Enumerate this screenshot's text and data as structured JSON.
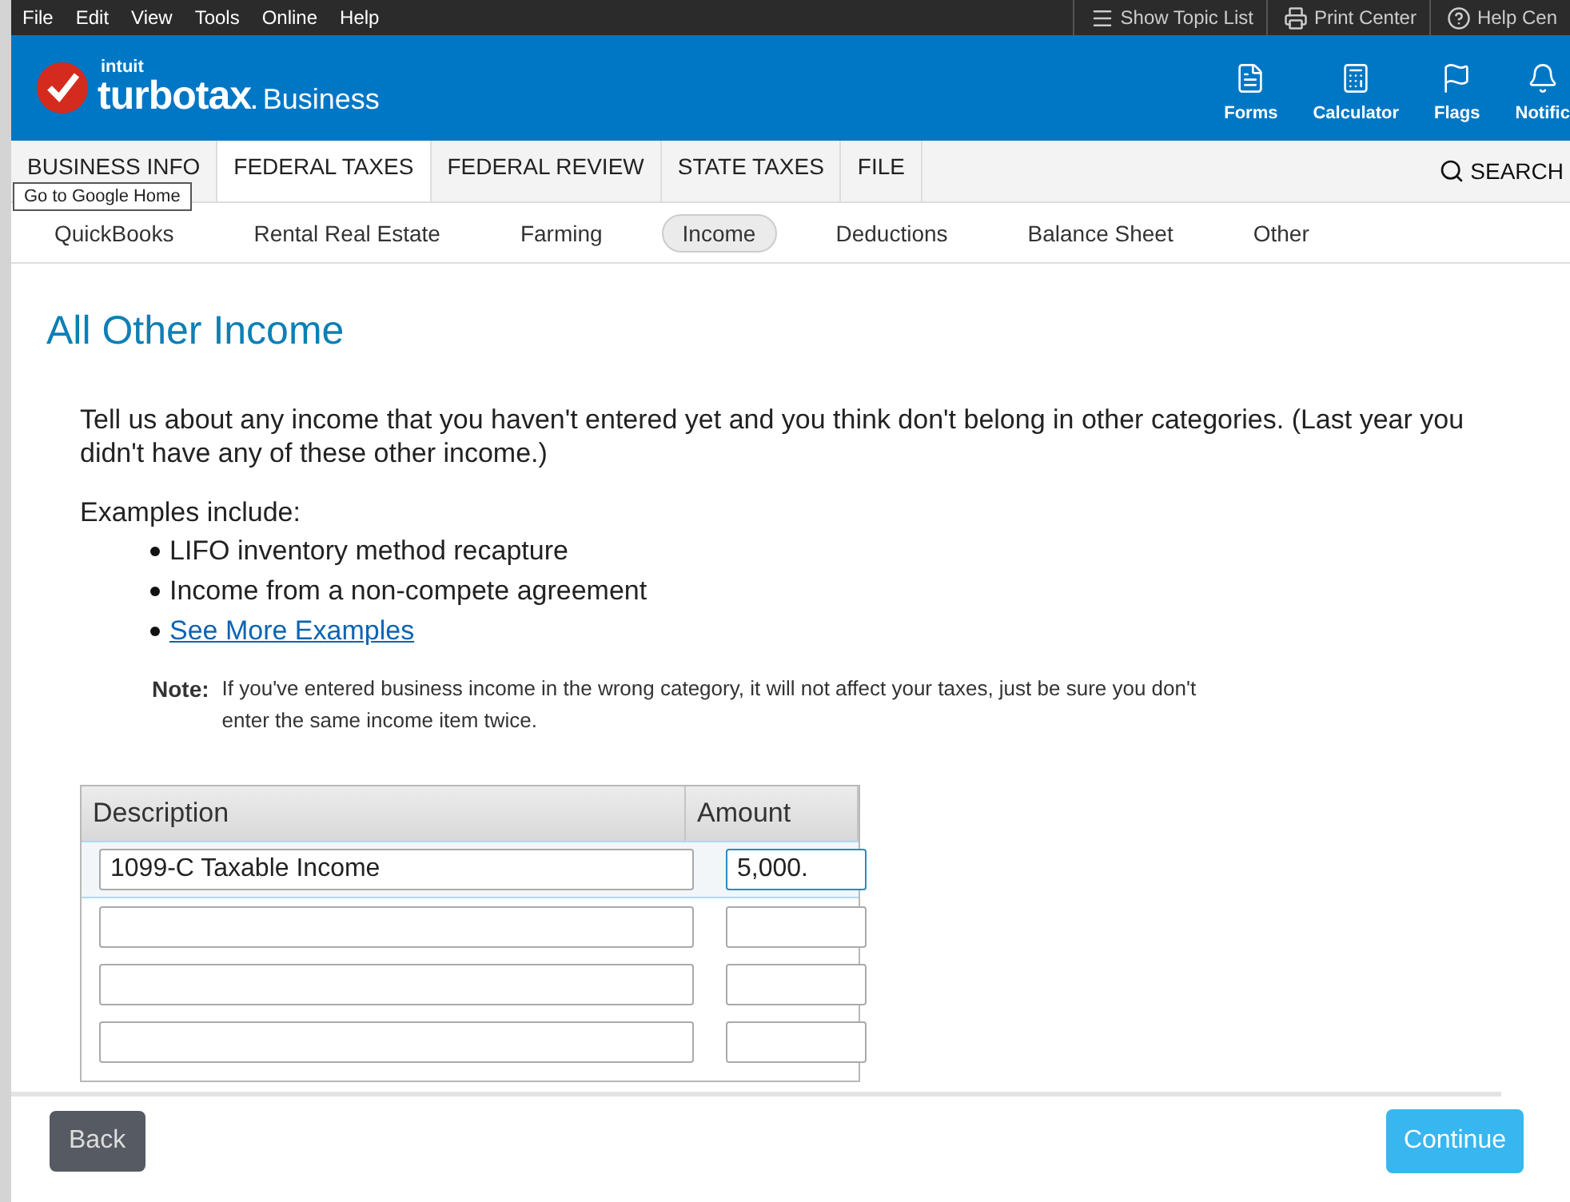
{
  "menu_bar": {
    "menus": [
      "File",
      "Edit",
      "View",
      "Tools",
      "Online",
      "Help"
    ],
    "tools": [
      {
        "kind": "list",
        "label": "Show Topic List"
      },
      {
        "kind": "print",
        "label": "Print Center"
      },
      {
        "kind": "help",
        "label": "Help Cen"
      }
    ]
  },
  "header": {
    "brand_top": "intuit",
    "brand": "turbotax",
    "brand_dot": ".",
    "edition": "Business",
    "actions": [
      {
        "kind": "forms",
        "label": "Forms"
      },
      {
        "kind": "calculator",
        "label": "Calculator"
      },
      {
        "kind": "flags",
        "label": "Flags"
      },
      {
        "kind": "bell",
        "label": "Notific"
      }
    ]
  },
  "tabs": [
    {
      "label": "BUSINESS INFO",
      "selected": false
    },
    {
      "label": "FEDERAL TAXES",
      "selected": true
    },
    {
      "label": "FEDERAL REVIEW",
      "selected": false
    },
    {
      "label": "STATE TAXES",
      "selected": false
    },
    {
      "label": "FILE",
      "selected": false
    }
  ],
  "search": {
    "label": "SEARCH"
  },
  "tooltip": "Go to Google Home",
  "subnav": [
    {
      "label": "QuickBooks",
      "selected": false
    },
    {
      "label": "Rental Real Estate",
      "selected": false
    },
    {
      "label": "Farming",
      "selected": false
    },
    {
      "label": "Income",
      "selected": true
    },
    {
      "label": "Deductions",
      "selected": false
    },
    {
      "label": "Balance Sheet",
      "selected": false
    },
    {
      "label": "Other",
      "selected": false
    }
  ],
  "page": {
    "title": "All Other Income",
    "intro": "Tell us about any income that you haven't entered yet and you think don't belong in other categories. (Last year you didn't have any of these other income.)",
    "examples_heading": "Examples include:",
    "examples": [
      {
        "kind": "text",
        "text": "LIFO inventory method recapture"
      },
      {
        "kind": "text",
        "text": "Income from a non-compete agreement"
      },
      {
        "kind": "link",
        "text": "See More Examples"
      }
    ],
    "note_label": "Note:",
    "note": "If you've entered business income in the wrong category, it will not affect your taxes, just be sure you don't enter the same income item twice."
  },
  "table": {
    "columns": [
      "Description",
      "Amount"
    ],
    "rows": [
      {
        "description": "1099-C Taxable Income",
        "amount": "5,000.",
        "selected": true
      },
      {
        "selected": false
      },
      {
        "selected": false
      },
      {
        "selected": false
      }
    ]
  },
  "buttons": {
    "back": "Back",
    "continue": "Continue"
  }
}
